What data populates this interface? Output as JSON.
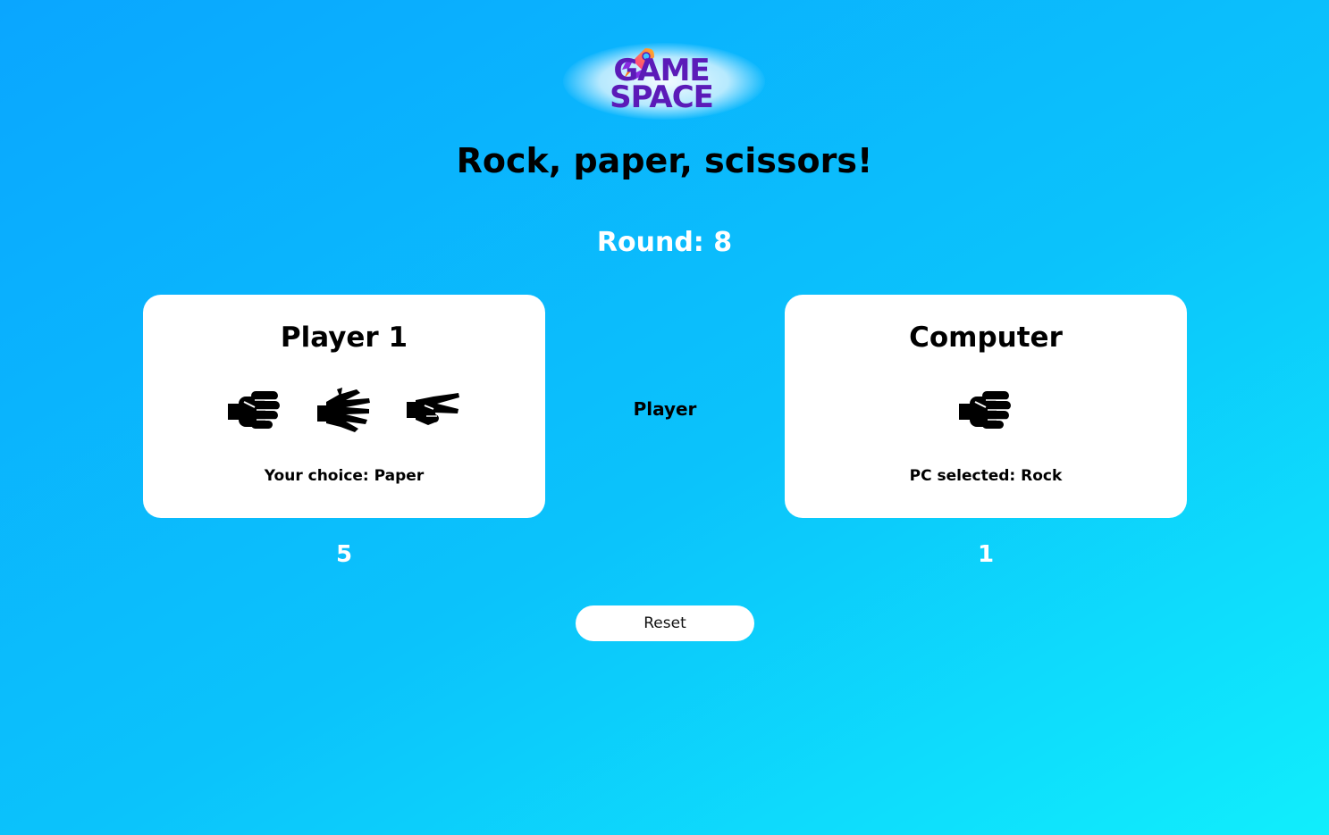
{
  "logo": {
    "line1": "GAME",
    "line2": "SPACE",
    "brand_color": "#5b1bb8"
  },
  "title": "Rock, paper, scissors!",
  "round": {
    "text": "Round: 8"
  },
  "player": {
    "title": "Player 1",
    "choices": [
      {
        "name": "rock",
        "icon": "hand-rock-icon"
      },
      {
        "name": "paper",
        "icon": "hand-paper-icon"
      },
      {
        "name": "scissors",
        "icon": "hand-scissors-icon"
      }
    ],
    "choice_text": "Your choice: Paper",
    "score": "5"
  },
  "computer": {
    "title": "Computer",
    "shown_icon": "hand-rock-icon",
    "choice_text": "PC selected: Rock",
    "score": "1"
  },
  "winner_text": "Player",
  "reset_label": "Reset",
  "colors": {
    "background_start": "#0aa6ff",
    "background_end": "#10eefc",
    "card": "#ffffff",
    "score_text": "#ffffff"
  }
}
